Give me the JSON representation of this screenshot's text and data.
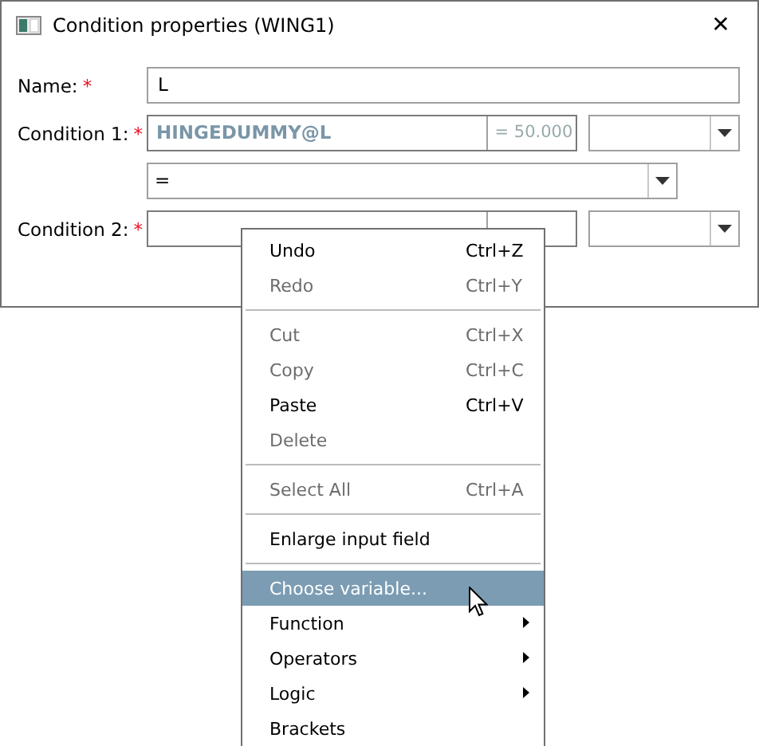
{
  "window": {
    "title": "Condition properties (WING1)",
    "close": "✕"
  },
  "form": {
    "name": {
      "label": "Name:",
      "required": "*",
      "value": "L"
    },
    "condition_1": {
      "label": "Condition 1:",
      "required": "*",
      "value": "HINGEDUMMY@L",
      "result": "= 50.000"
    },
    "operator": {
      "value": "="
    },
    "condition_2": {
      "label": "Condition 2:",
      "required": "*"
    }
  },
  "context_menu": [
    {
      "kind": "item",
      "label": "Undo",
      "shortcut": "Ctrl+Z",
      "disabled": false,
      "selected": false,
      "submenu": false
    },
    {
      "kind": "item",
      "label": "Redo",
      "shortcut": "Ctrl+Y",
      "disabled": true,
      "selected": false,
      "submenu": false
    },
    {
      "kind": "separator"
    },
    {
      "kind": "item",
      "label": "Cut",
      "shortcut": "Ctrl+X",
      "disabled": true,
      "selected": false,
      "submenu": false
    },
    {
      "kind": "item",
      "label": "Copy",
      "shortcut": "Ctrl+C",
      "disabled": true,
      "selected": false,
      "submenu": false
    },
    {
      "kind": "item",
      "label": "Paste",
      "shortcut": "Ctrl+V",
      "disabled": false,
      "selected": false,
      "submenu": false
    },
    {
      "kind": "item",
      "label": "Delete",
      "disabled": true,
      "selected": false,
      "submenu": false
    },
    {
      "kind": "separator"
    },
    {
      "kind": "item",
      "label": "Select All",
      "shortcut": "Ctrl+A",
      "disabled": true,
      "selected": false,
      "submenu": false
    },
    {
      "kind": "separator"
    },
    {
      "kind": "item",
      "label": "Enlarge input field",
      "disabled": false,
      "selected": false,
      "submenu": false
    },
    {
      "kind": "separator"
    },
    {
      "kind": "item",
      "label": "Choose variable...",
      "disabled": false,
      "selected": true,
      "submenu": false
    },
    {
      "kind": "item",
      "label": "Function",
      "disabled": false,
      "selected": false,
      "submenu": true
    },
    {
      "kind": "item",
      "label": "Operators",
      "disabled": false,
      "selected": false,
      "submenu": true
    },
    {
      "kind": "item",
      "label": "Logic",
      "disabled": false,
      "selected": false,
      "submenu": true
    },
    {
      "kind": "item",
      "label": "Brackets",
      "disabled": false,
      "selected": false,
      "submenu": false
    }
  ]
}
